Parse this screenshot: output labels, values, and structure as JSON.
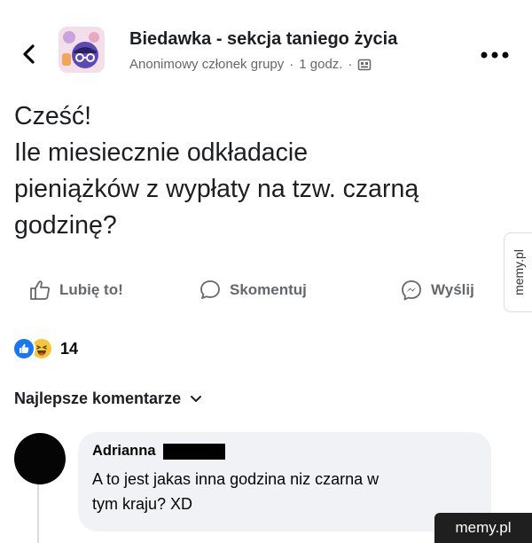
{
  "header": {
    "group_name": "Biedawka - sekcja taniego życia",
    "author_label": "Anonimowy członek grupy",
    "separator": "·",
    "time": "1 godz.",
    "separator2": "·"
  },
  "post": {
    "lines": [
      "Cześć!",
      "Ile miesiecznie odkładacie",
      "pieniążków z wypłaty na tzw. czarną",
      "godzinę?"
    ]
  },
  "actions": {
    "like": "Lubię to!",
    "comment": "Skomentuj",
    "send": "Wyślij"
  },
  "reactions": {
    "count": "14",
    "icons": [
      "like-reaction-icon",
      "haha-reaction-icon"
    ]
  },
  "comments_section": {
    "title": "Najlepsze komentarze"
  },
  "comment": {
    "author": "Adrianna",
    "lines": [
      "A to jest jakas inna godzina niz czarna w",
      "tym kraju? XD"
    ]
  },
  "watermark": {
    "side": "memy.pl",
    "corner": "memy.pl"
  },
  "colors": {
    "accent": "#1877f2",
    "secondary_text": "#65676b",
    "bubble": "#f0f2f5",
    "haha": "#f7c638"
  }
}
